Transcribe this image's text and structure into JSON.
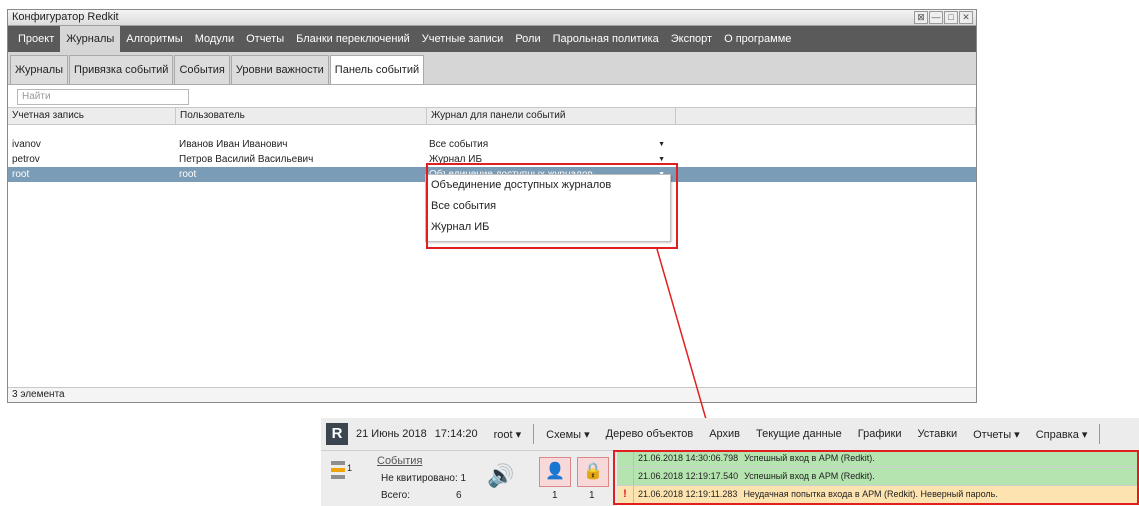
{
  "window": {
    "title": "Конфигуратор Redkit",
    "controls": [
      "⊠",
      "—",
      "□",
      "✕"
    ]
  },
  "menu": [
    "Проект",
    "Журналы",
    "Алгоритмы",
    "Модули",
    "Отчеты",
    "Бланки переключений",
    "Учетные записи",
    "Роли",
    "Парольная политика",
    "Экспорт",
    "О программе"
  ],
  "subtabs": [
    "Журналы",
    "Привязка событий",
    "События",
    "Уровни важности",
    "Панель событий"
  ],
  "search": {
    "placeholder": "Найти"
  },
  "table": {
    "headers": [
      "Учетная запись",
      "Пользователь",
      "Журнал для панели событий"
    ],
    "rows": [
      {
        "account": "ivanov",
        "user": "Иванов Иван Иванович",
        "journal": "Все события"
      },
      {
        "account": "petrov",
        "user": "Петров Василий Васильевич",
        "journal": "Журнал ИБ"
      },
      {
        "account": "root",
        "user": "root",
        "journal": "Объединение доступных журналов"
      }
    ]
  },
  "dropdown": [
    "Объединение доступных журналов",
    "Все события",
    "Журнал ИБ"
  ],
  "status": "3 элемента",
  "apm": {
    "logo": "R",
    "date": "21 Июнь 2018",
    "time": "17:14:20",
    "user": "root ▾",
    "menu": [
      "Схемы ▾",
      "Дерево объектов",
      "Архив",
      "Текущие данные",
      "Графики",
      "Уставки",
      "Отчеты ▾",
      "Справка ▾"
    ],
    "level_count": "1",
    "events_link": "События",
    "unacked": "Не квитировано: 1",
    "total": "Всего:",
    "total_value": "6",
    "btn1_count": "1",
    "btn2_count": "1",
    "events": [
      {
        "time": "21.06.2018 14:30:06.798",
        "text": "Успешный вход в АРМ (Redkit).",
        "type": "ok"
      },
      {
        "time": "21.06.2018 12:19:17.540",
        "text": "Успешный вход в АРМ (Redkit).",
        "type": "ok"
      },
      {
        "time": "21.06.2018 12:19:11.283",
        "text": "Неудачная попытка входа в АРМ (Redkit). Неверный пароль.",
        "type": "warn"
      }
    ]
  }
}
